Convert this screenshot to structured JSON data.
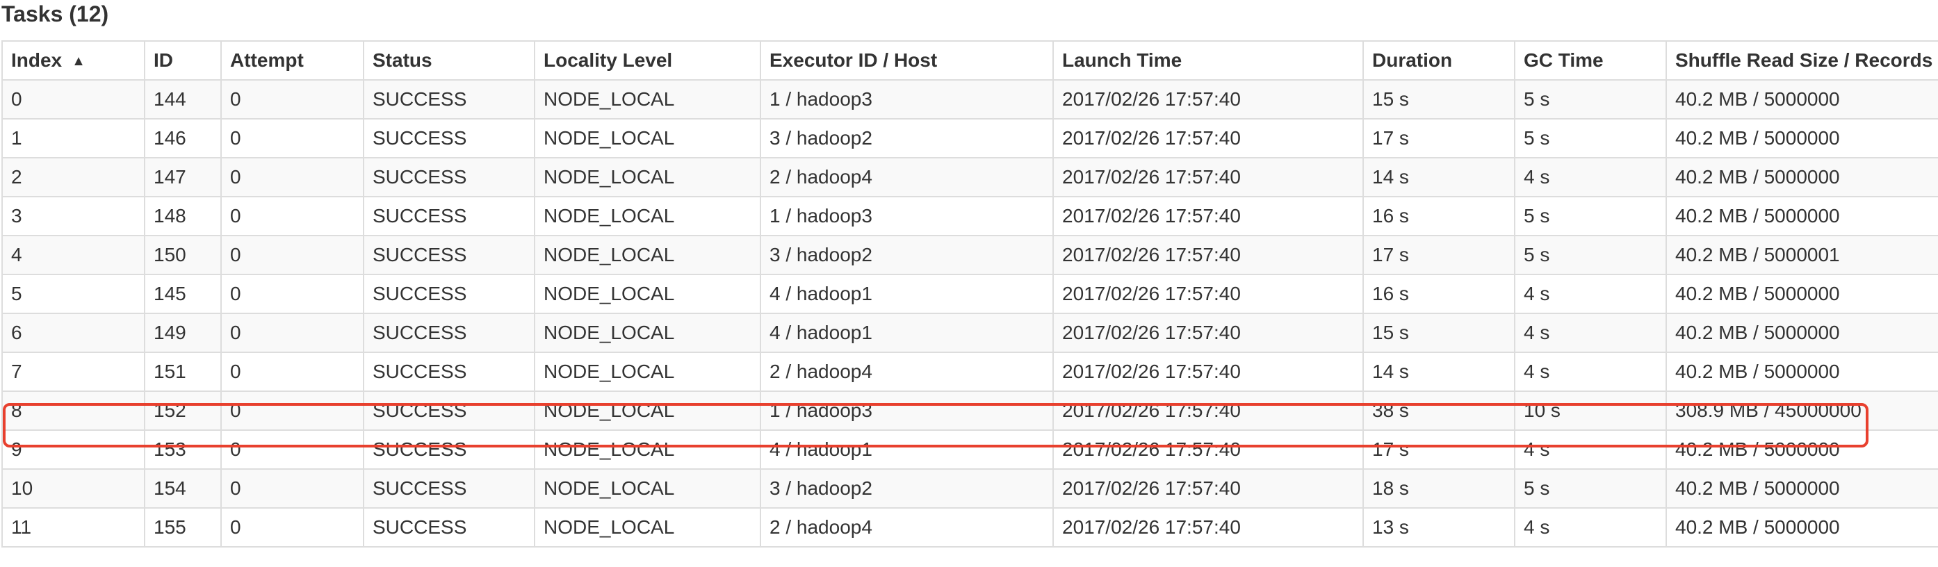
{
  "title": "Tasks (12)",
  "sort_indicator": "▲",
  "columns": [
    "Index",
    "ID",
    "Attempt",
    "Status",
    "Locality Level",
    "Executor ID / Host",
    "Launch Time",
    "Duration",
    "GC Time",
    "Shuffle Read Size / Records"
  ],
  "rows": [
    [
      "0",
      "144",
      "0",
      "SUCCESS",
      "NODE_LOCAL",
      "1 / hadoop3",
      "2017/02/26 17:57:40",
      "15 s",
      "5 s",
      "40.2 MB / 5000000"
    ],
    [
      "1",
      "146",
      "0",
      "SUCCESS",
      "NODE_LOCAL",
      "3 / hadoop2",
      "2017/02/26 17:57:40",
      "17 s",
      "5 s",
      "40.2 MB / 5000000"
    ],
    [
      "2",
      "147",
      "0",
      "SUCCESS",
      "NODE_LOCAL",
      "2 / hadoop4",
      "2017/02/26 17:57:40",
      "14 s",
      "4 s",
      "40.2 MB / 5000000"
    ],
    [
      "3",
      "148",
      "0",
      "SUCCESS",
      "NODE_LOCAL",
      "1 / hadoop3",
      "2017/02/26 17:57:40",
      "16 s",
      "5 s",
      "40.2 MB / 5000000"
    ],
    [
      "4",
      "150",
      "0",
      "SUCCESS",
      "NODE_LOCAL",
      "3 / hadoop2",
      "2017/02/26 17:57:40",
      "17 s",
      "5 s",
      "40.2 MB / 5000001"
    ],
    [
      "5",
      "145",
      "0",
      "SUCCESS",
      "NODE_LOCAL",
      "4 / hadoop1",
      "2017/02/26 17:57:40",
      "16 s",
      "4 s",
      "40.2 MB / 5000000"
    ],
    [
      "6",
      "149",
      "0",
      "SUCCESS",
      "NODE_LOCAL",
      "4 / hadoop1",
      "2017/02/26 17:57:40",
      "15 s",
      "4 s",
      "40.2 MB / 5000000"
    ],
    [
      "7",
      "151",
      "0",
      "SUCCESS",
      "NODE_LOCAL",
      "2 / hadoop4",
      "2017/02/26 17:57:40",
      "14 s",
      "4 s",
      "40.2 MB / 5000000"
    ],
    [
      "8",
      "152",
      "0",
      "SUCCESS",
      "NODE_LOCAL",
      "1 / hadoop3",
      "2017/02/26 17:57:40",
      "38 s",
      "10 s",
      "308.9 MB / 45000000"
    ],
    [
      "9",
      "153",
      "0",
      "SUCCESS",
      "NODE_LOCAL",
      "4 / hadoop1",
      "2017/02/26 17:57:40",
      "17 s",
      "4 s",
      "40.2 MB / 5000000"
    ],
    [
      "10",
      "154",
      "0",
      "SUCCESS",
      "NODE_LOCAL",
      "3 / hadoop2",
      "2017/02/26 17:57:40",
      "18 s",
      "5 s",
      "40.2 MB / 5000000"
    ],
    [
      "11",
      "155",
      "0",
      "SUCCESS",
      "NODE_LOCAL",
      "2 / hadoop4",
      "2017/02/26 17:57:40",
      "13 s",
      "4 s",
      "40.2 MB / 5000000"
    ]
  ],
  "highlighted_row": 8,
  "colors": {
    "highlight": "#e8402e",
    "border": "#dddddd",
    "stripe": "#f9f9f9"
  }
}
